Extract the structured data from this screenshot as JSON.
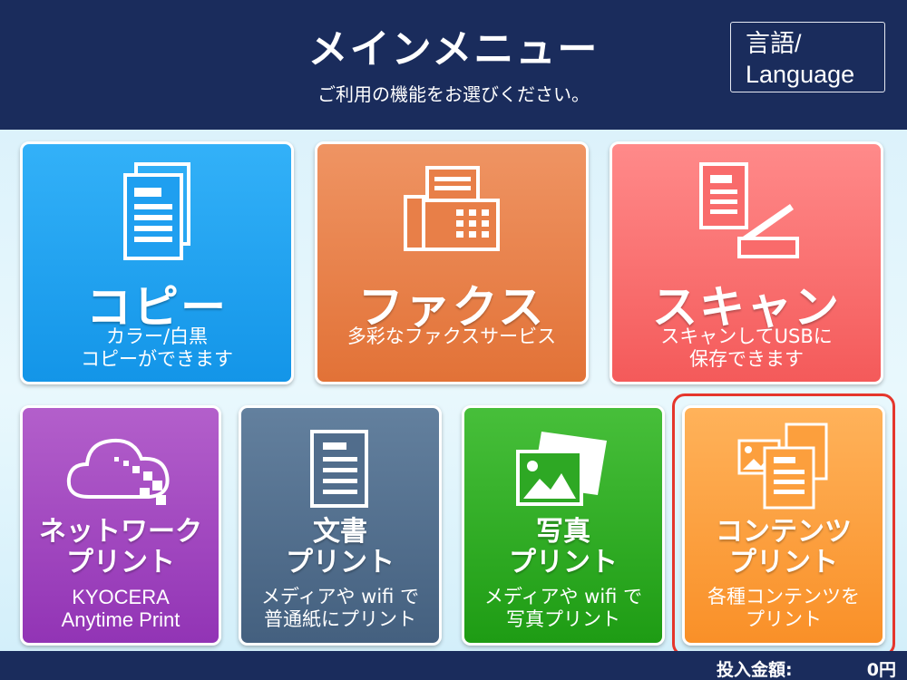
{
  "header": {
    "title": "メインメニュー",
    "subtitle": "ご利用の機能をお選びください。",
    "language_line1": "言語/",
    "language_line2": "Language"
  },
  "tiles": {
    "copy": {
      "label": "コピー",
      "desc1": "カラー/白黒",
      "desc2": "コピーができます",
      "icon": "copy-icon",
      "color": "#1f9ff0"
    },
    "fax": {
      "label": "ファクス",
      "desc1": "多彩なファクスサービス",
      "icon": "fax-icon",
      "color": "#e87f48"
    },
    "scan": {
      "label": "スキャン",
      "desc1": "スキャンしてUSBに",
      "desc2": "保存できます",
      "icon": "scanner-icon",
      "color": "#f96b6b"
    },
    "network": {
      "label1": "ネットワーク",
      "label2": "プリント",
      "desc1": "KYOCERA",
      "desc2": "Anytime Print",
      "icon": "cloud-icon",
      "color": "#a047c0"
    },
    "document": {
      "label1": "文書",
      "label2": "プリント",
      "desc1": "メディアや wifi で",
      "desc2": "普通紙にプリント",
      "icon": "document-icon",
      "color": "#516d8c"
    },
    "photo": {
      "label1": "写真",
      "label2": "プリント",
      "desc1": "メディアや wifi で",
      "desc2": "写真プリント",
      "icon": "photo-icon",
      "color": "#2ea824"
    },
    "contents": {
      "label1": "コンテンツ",
      "label2": "プリント",
      "desc1": "各種コンテンツを",
      "desc2": "プリント",
      "icon": "contents-icon",
      "color": "#fc9f3d"
    }
  },
  "footer": {
    "amount_label": "投入金額:",
    "amount_value": "0円"
  },
  "highlight_color": "#e5362c"
}
